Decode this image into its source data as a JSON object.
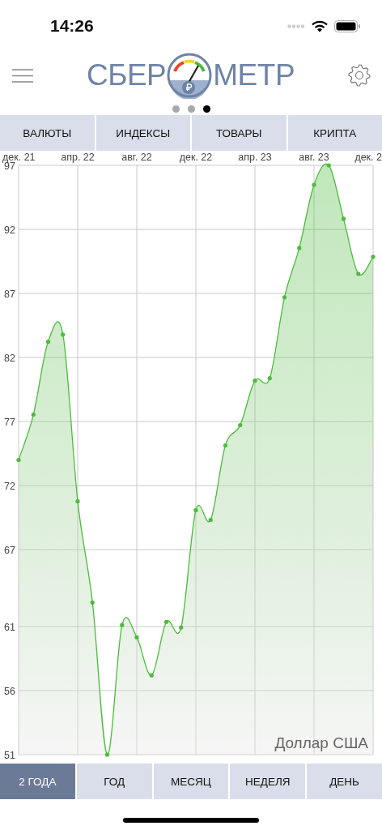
{
  "status_bar": {
    "time": "14:26"
  },
  "header": {
    "logo_left": "СБЕР",
    "logo_right": "МЕТР"
  },
  "pager": {
    "dots": [
      {
        "selected": false
      },
      {
        "selected": false
      },
      {
        "selected": true
      }
    ]
  },
  "categories": [
    {
      "label": "ВАЛЮТЫ",
      "selected": false
    },
    {
      "label": "ИНДЕКСЫ",
      "selected": false
    },
    {
      "label": "ТОВАРЫ",
      "selected": false
    },
    {
      "label": "КРИПТА",
      "selected": false
    }
  ],
  "chart": {
    "chart_data": {
      "type": "area",
      "categories": [
        "дек. 21",
        null,
        null,
        null,
        "апр. 22",
        null,
        null,
        null,
        "авг. 22",
        null,
        null,
        null,
        "дек. 22",
        null,
        null,
        null,
        "апр. 23",
        null,
        null,
        null,
        "авг. 23",
        null,
        null,
        null,
        "дек. 2"
      ],
      "series": [
        {
          "name": "Доллар США",
          "color": "#4dbb3c",
          "values": [
            74.0,
            77.54,
            83.23,
            83.79,
            70.78,
            62.88,
            51.0,
            61.11,
            60.16,
            57.19,
            61.36,
            60.92,
            70.08,
            69.32,
            75.14,
            76.72,
            80.19,
            80.38,
            86.7,
            90.55,
            95.48,
            97.0,
            92.83,
            88.53,
            89.86
          ]
        }
      ],
      "ylim": [
        51,
        97
      ],
      "grid": true,
      "yticks": [
        51,
        56,
        61,
        67,
        72,
        77,
        82,
        87,
        92,
        97
      ]
    }
  },
  "periods": [
    {
      "label": "2 ГОДА",
      "selected": true
    },
    {
      "label": "ГОД",
      "selected": false
    },
    {
      "label": "МЕСЯЦ",
      "selected": false
    },
    {
      "label": "НЕДЕЛЯ",
      "selected": false
    },
    {
      "label": "ДЕНЬ",
      "selected": false
    }
  ]
}
